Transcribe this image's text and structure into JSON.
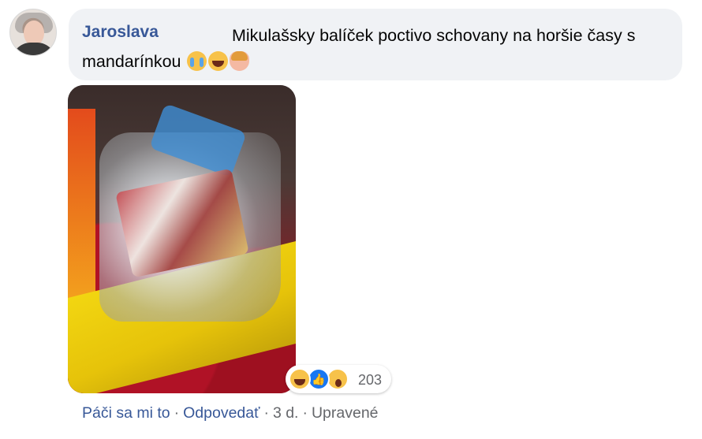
{
  "comment": {
    "author": "Jaroslava",
    "text": "Mikulašsky balíček poctivo schovany na horšie časy s mandarínkou",
    "text_emojis": [
      "loudly-crying-face",
      "face-with-tears-of-joy",
      "person-gesturing-ok"
    ],
    "attachment": "photo-of-wrapped-package",
    "reactions": {
      "icons": [
        "haha-reaction-icon",
        "like-reaction-icon",
        "wow-reaction-icon"
      ],
      "count": "203"
    },
    "actions": {
      "like_label": "Páči sa mi to",
      "reply_label": "Odpovedať",
      "separator": "·",
      "time": "3 d.",
      "edited": "Upravené"
    }
  },
  "colors": {
    "bubble": "#f0f2f5",
    "author": "#385898",
    "link": "#385898",
    "muted": "#65676b",
    "like_blue": "#1877f2",
    "emoji_yellow": "#f7c24a"
  }
}
